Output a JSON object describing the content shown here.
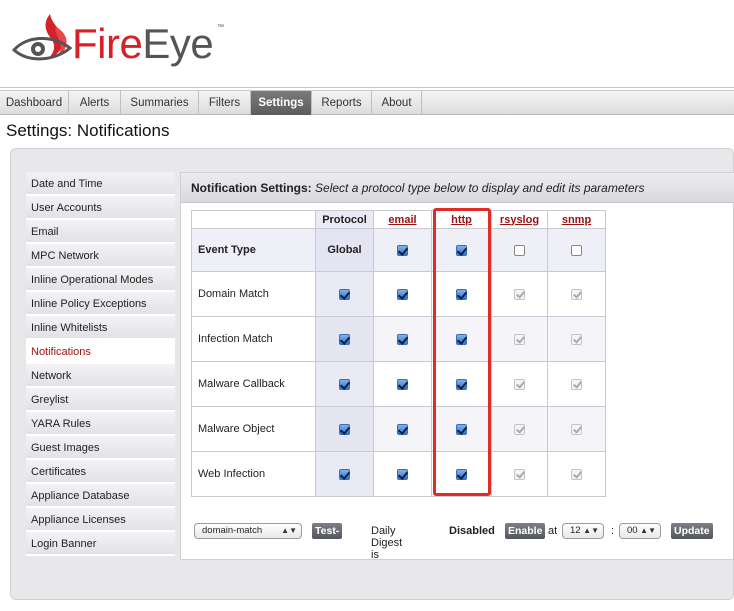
{
  "brand": {
    "fire": "Fire",
    "eye": "Eye",
    "tm": "™"
  },
  "colors": {
    "brand_red": "#d2232a",
    "highlight": "#e12b25",
    "link": "#9b1010"
  },
  "tabs": [
    {
      "label": "Dashboard"
    },
    {
      "label": "Alerts"
    },
    {
      "label": "Summaries"
    },
    {
      "label": "Filters"
    },
    {
      "label": "Settings",
      "active": true
    },
    {
      "label": "Reports"
    },
    {
      "label": "About"
    }
  ],
  "page_title": "Settings: Notifications",
  "sidebar": {
    "items": [
      "Date and Time",
      "User Accounts",
      "Email",
      "MPC Network",
      "Inline Operational Modes",
      "Inline Policy Exceptions",
      "Inline Whitelists",
      "Notifications",
      "Network",
      "Greylist",
      "YARA Rules",
      "Guest Images",
      "Certificates",
      "Appliance Database",
      "Appliance Licenses",
      "Login Banner"
    ],
    "active": "Notifications"
  },
  "section": {
    "title": "Notification Settings:",
    "subtitle": "Select a protocol type below to display and edit its parameters"
  },
  "table": {
    "protocol_header": "Protocol",
    "protocols": [
      "email",
      "http",
      "rsyslog",
      "snmp"
    ],
    "event_type_label": "Event Type",
    "global_label": "Global",
    "global_checks": [
      "checked",
      "checked",
      "unchecked",
      "unchecked"
    ],
    "rows": [
      {
        "label": "Domain Match",
        "checks": [
          "checked",
          "checked",
          "checked",
          "disabled",
          "disabled"
        ]
      },
      {
        "label": "Infection Match",
        "checks": [
          "checked",
          "checked",
          "checked",
          "disabled",
          "disabled"
        ]
      },
      {
        "label": "Malware Callback",
        "checks": [
          "checked",
          "checked",
          "checked",
          "disabled",
          "disabled"
        ]
      },
      {
        "label": "Malware Object",
        "checks": [
          "checked",
          "checked",
          "checked",
          "disabled",
          "disabled"
        ]
      },
      {
        "label": "Web Infection",
        "checks": [
          "checked",
          "checked",
          "checked",
          "disabled",
          "disabled"
        ]
      }
    ]
  },
  "controls": {
    "event_select": "domain-match",
    "test_fire": "Test-Fire",
    "daily_digest_label": "Daily Digest is",
    "daily_digest_status": "Disabled",
    "enable_button": "Enable",
    "at_label": "at",
    "hour": "12",
    "colon": ":",
    "minute": "00",
    "update_button": "Update"
  }
}
